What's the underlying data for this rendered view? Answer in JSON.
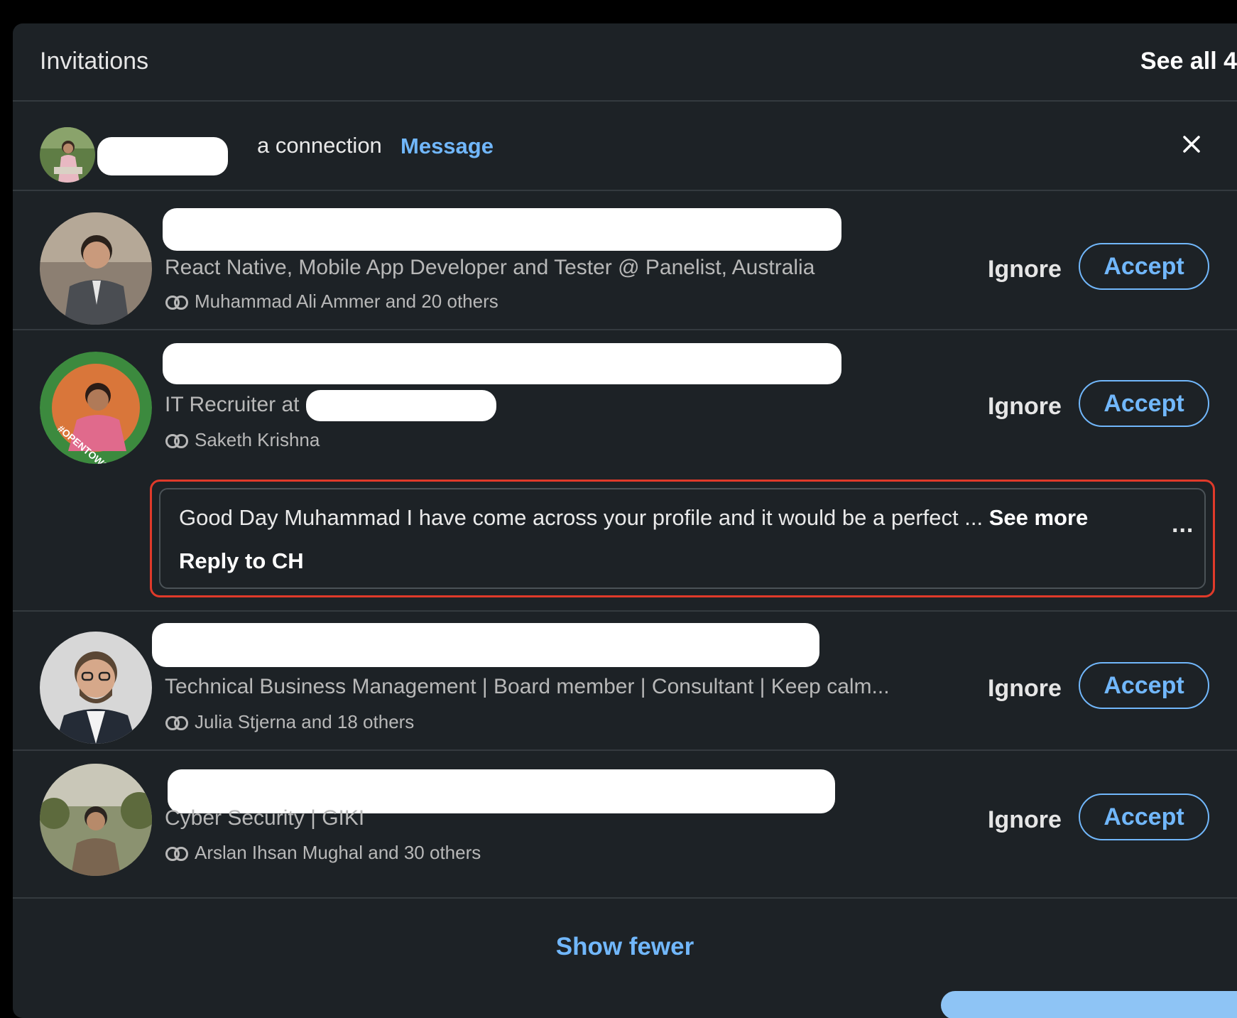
{
  "header": {
    "title": "Invitations",
    "see_all": "See all 4"
  },
  "connection_notice": {
    "text": "a connection",
    "message_label": "Message"
  },
  "invitations": [
    {
      "headline": "React Native, Mobile App Developer and Tester @ Panelist, Australia",
      "mutual": "Muhammad Ali Ammer and 20 others",
      "ignore_label": "Ignore",
      "accept_label": "Accept"
    },
    {
      "headline": "IT Recruiter at",
      "mutual": "Saketh Krishna",
      "ignore_label": "Ignore",
      "accept_label": "Accept",
      "message": {
        "text": "Good Day Muhammad I have come across your profile and it would be a perfect ...",
        "see_more": "See more",
        "reply": "Reply to CH",
        "more_menu": "..."
      }
    },
    {
      "headline": "Technical Business Management | Board member | Consultant | Keep calm...",
      "mutual": "Julia Stjerna and 18 others",
      "ignore_label": "Ignore",
      "accept_label": "Accept"
    },
    {
      "headline": "Cyber Security | GIKI",
      "mutual": "Arslan Ihsan Mughal and 30 others",
      "ignore_label": "Ignore",
      "accept_label": "Accept"
    }
  ],
  "footer": {
    "show_fewer": "Show fewer"
  },
  "colors": {
    "background": "#1d2226",
    "accent": "#71b7fb",
    "highlight_border": "#e03a2a",
    "divider": "#343a3f"
  }
}
